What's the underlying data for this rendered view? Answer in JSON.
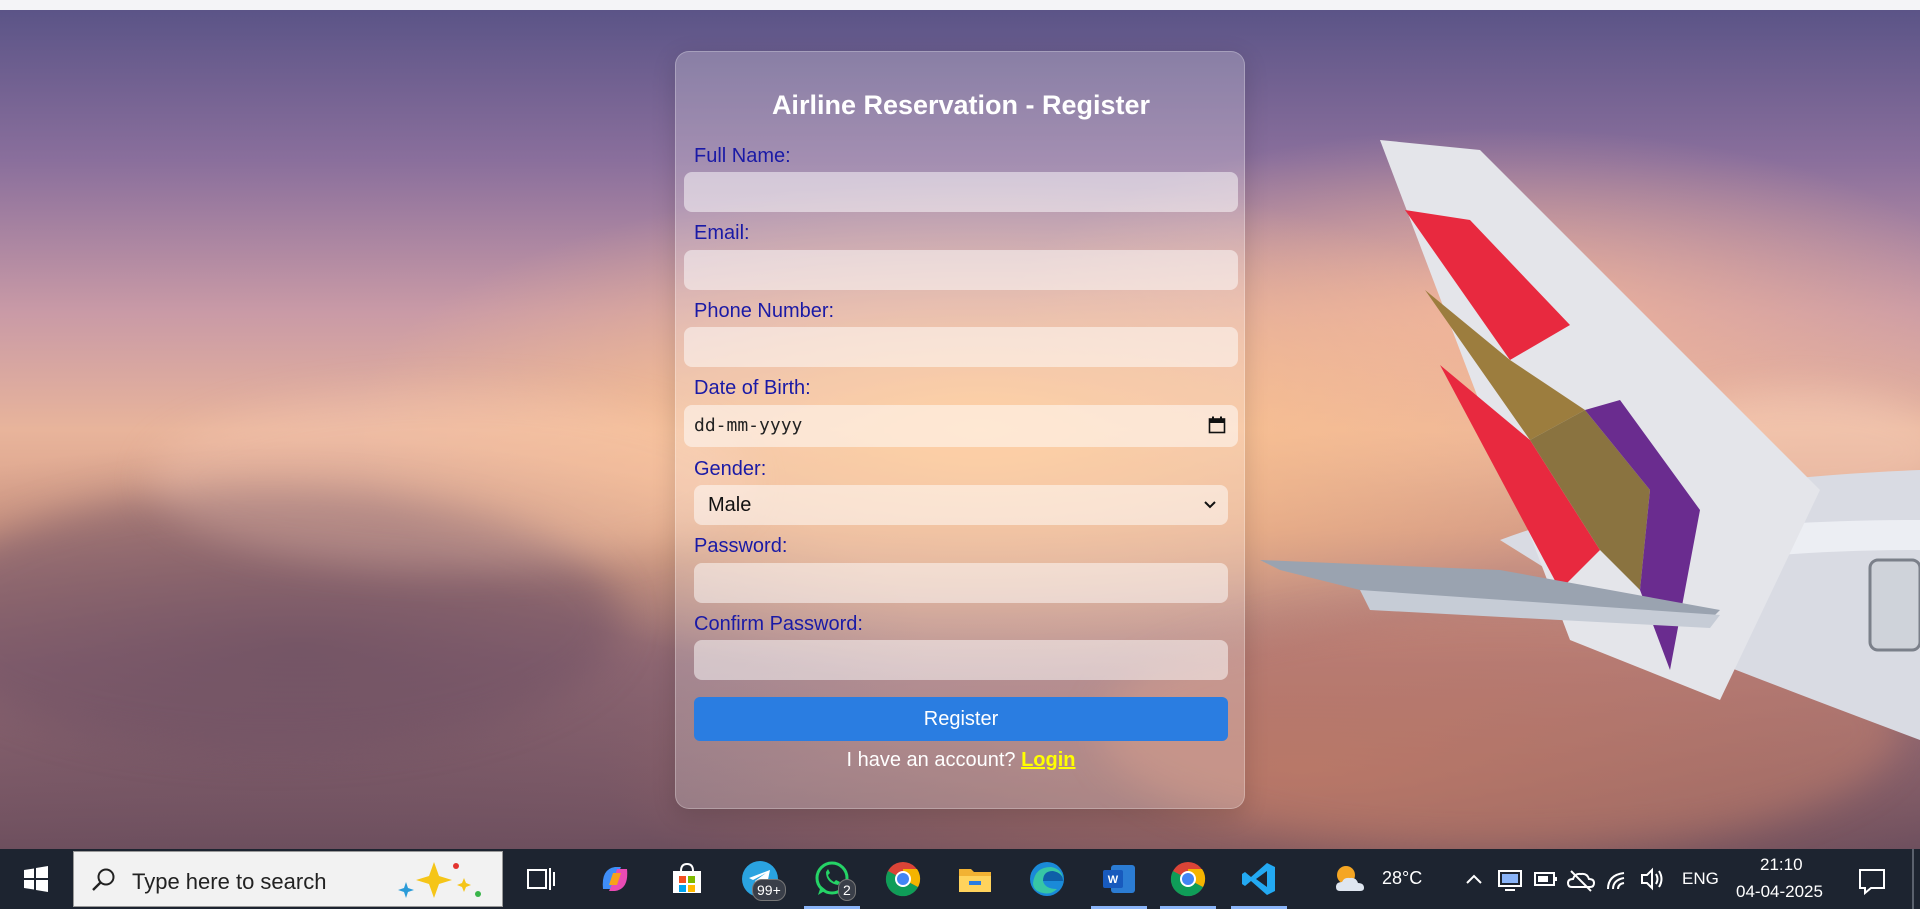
{
  "form": {
    "title": "Airline Reservation - Register",
    "labels": {
      "full_name": "Full Name:",
      "email": "Email:",
      "phone": "Phone Number:",
      "dob": "Date of Birth:",
      "gender": "Gender:",
      "password": "Password:",
      "confirm_password": "Confirm Password:"
    },
    "values": {
      "full_name": "",
      "email": "",
      "phone": "",
      "dob_placeholder": "dd-mm-yyyy",
      "gender_selected": "Male",
      "password": "",
      "confirm_password": ""
    },
    "register_button": "Register",
    "account_prompt": "I have an account?",
    "login_link": "Login"
  },
  "taskbar": {
    "search_placeholder": "Type here to search",
    "telegram_badge": "99+",
    "whatsapp_badge": "2",
    "weather_temp": "28°C",
    "language": "ENG",
    "time": "21:10",
    "date": "04-04-2025",
    "apps": [
      "task-view",
      "copilot",
      "microsoft-store",
      "telegram",
      "whatsapp",
      "chrome",
      "file-explorer",
      "edge",
      "word",
      "chrome",
      "vscode"
    ]
  },
  "colors": {
    "label": "#1a1aa6",
    "button": "#2a7de1",
    "login_link": "#ffff00",
    "taskbar": "#1d2430"
  }
}
